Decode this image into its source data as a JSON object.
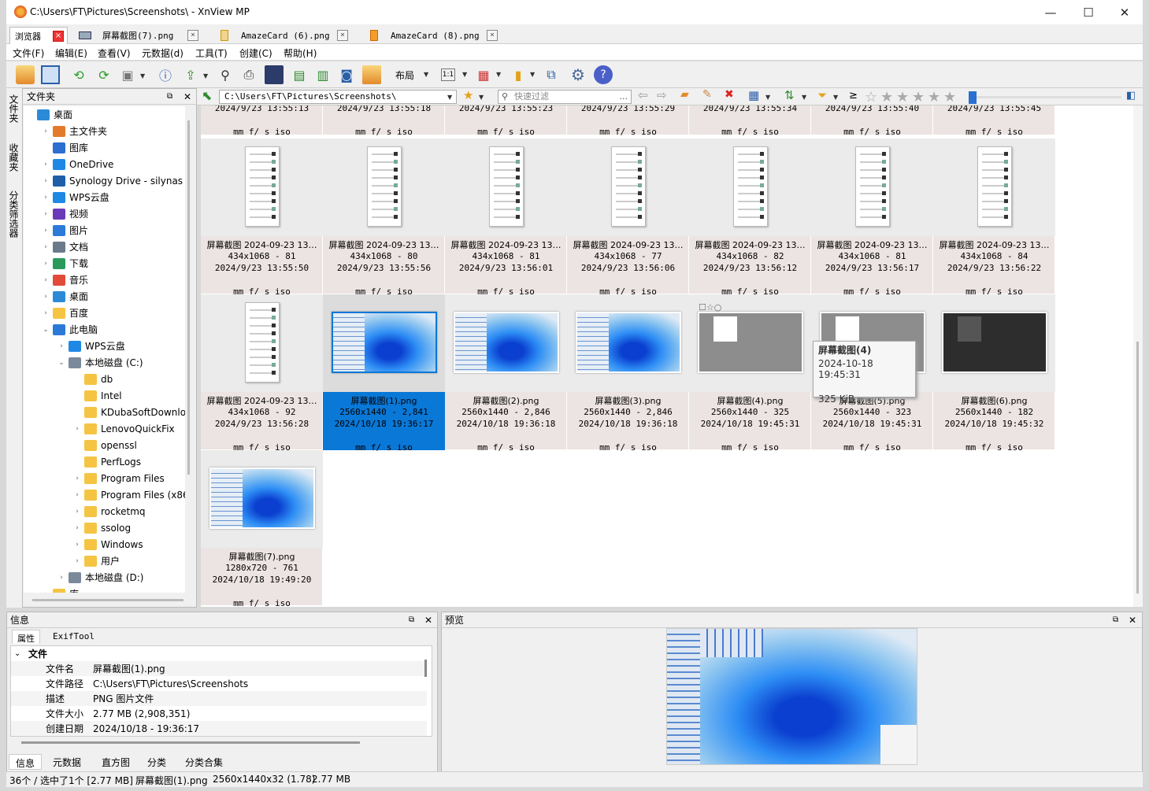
{
  "window": {
    "title": "C:\\Users\\FT\\Pictures\\Screenshots\\ - XnView MP",
    "minimize": "—",
    "maximize": "☐",
    "close": "✕"
  },
  "tabs": [
    {
      "label": "浏览器"
    },
    {
      "label": "屏幕截图(7).png"
    },
    {
      "label": "AmazeCard (6).png"
    },
    {
      "label": "AmazeCard (8).png"
    }
  ],
  "menu": [
    "文件(F)",
    "编辑(E)",
    "查看(V)",
    "元数据(d)",
    "工具(T)",
    "创建(C)",
    "帮助(H)"
  ],
  "toolbar": {
    "layout_label": "布局",
    "icons": [
      "open-folder-icon",
      "fullscreen-icon",
      "rotate-left-icon",
      "rotate-right-icon",
      "image-settings-icon",
      "info-icon",
      "export-icon",
      "binoculars-icon",
      "print-icon",
      "scanner-icon",
      "slideshow-icon",
      "batch-icon",
      "capture-icon",
      "desktop-icon",
      "grid-size-icon",
      "color-icon",
      "bookmark-icon",
      "compare-icon",
      "settings-icon",
      "help-icon"
    ]
  },
  "left_rail": [
    "文件夹",
    "收藏夹",
    "分类筛选器"
  ],
  "folder_panel": {
    "title": "文件夹",
    "tree": [
      {
        "label": "桌面",
        "depth": 0,
        "expander": "",
        "icon": "desktop"
      },
      {
        "label": "主文件夹",
        "depth": 1,
        "expander": "›",
        "icon": "home"
      },
      {
        "label": "图库",
        "depth": 1,
        "expander": "",
        "icon": "gallery"
      },
      {
        "label": "OneDrive",
        "depth": 1,
        "expander": "›",
        "icon": "cloud"
      },
      {
        "label": "Synology Drive - silynas",
        "depth": 1,
        "expander": "›",
        "icon": "synology"
      },
      {
        "label": "WPS云盘",
        "depth": 1,
        "expander": "›",
        "icon": "cloud"
      },
      {
        "label": "视频",
        "depth": 1,
        "expander": "›",
        "icon": "video"
      },
      {
        "label": "图片",
        "depth": 1,
        "expander": "›",
        "icon": "pictures"
      },
      {
        "label": "文档",
        "depth": 1,
        "expander": "›",
        "icon": "docs"
      },
      {
        "label": "下载",
        "depth": 1,
        "expander": "›",
        "icon": "download"
      },
      {
        "label": "音乐",
        "depth": 1,
        "expander": "›",
        "icon": "music"
      },
      {
        "label": "桌面",
        "depth": 1,
        "expander": "›",
        "icon": "desktop"
      },
      {
        "label": "百度",
        "depth": 1,
        "expander": "›",
        "icon": "folder"
      },
      {
        "label": "此电脑",
        "depth": 1,
        "expander": "⌄",
        "icon": "pc"
      },
      {
        "label": "WPS云盘",
        "depth": 2,
        "expander": "›",
        "icon": "cloud"
      },
      {
        "label": "本地磁盘 (C:)",
        "depth": 2,
        "expander": "⌄",
        "icon": "drive"
      },
      {
        "label": "db",
        "depth": 3,
        "expander": "",
        "icon": "folder"
      },
      {
        "label": "Intel",
        "depth": 3,
        "expander": "",
        "icon": "folder"
      },
      {
        "label": "KDubaSoftDownloads",
        "depth": 3,
        "expander": "",
        "icon": "folder"
      },
      {
        "label": "LenovoQuickFix",
        "depth": 3,
        "expander": "›",
        "icon": "folder"
      },
      {
        "label": "openssl",
        "depth": 3,
        "expander": "",
        "icon": "folder"
      },
      {
        "label": "PerfLogs",
        "depth": 3,
        "expander": "",
        "icon": "folder"
      },
      {
        "label": "Program Files",
        "depth": 3,
        "expander": "›",
        "icon": "folder"
      },
      {
        "label": "Program Files (x86)",
        "depth": 3,
        "expander": "›",
        "icon": "folder"
      },
      {
        "label": "rocketmq",
        "depth": 3,
        "expander": "›",
        "icon": "folder"
      },
      {
        "label": "ssolog",
        "depth": 3,
        "expander": "›",
        "icon": "folder"
      },
      {
        "label": "Windows",
        "depth": 3,
        "expander": "›",
        "icon": "folder"
      },
      {
        "label": "用户",
        "depth": 3,
        "expander": "›",
        "icon": "folder"
      },
      {
        "label": "本地磁盘 (D:)",
        "depth": 2,
        "expander": "›",
        "icon": "drive"
      },
      {
        "label": "库",
        "depth": 1,
        "expander": "›",
        "icon": "folder"
      }
    ]
  },
  "address": {
    "path": "C:\\Users\\FT\\Pictures\\Screenshots\\",
    "filter_placeholder": "快速过滤",
    "ge": "≥"
  },
  "thumbnails": {
    "row0": [
      {
        "date": "2024/9/23 13:55:13",
        "meta": "mm f/ s iso"
      },
      {
        "date": "2024/9/23 13:55:18",
        "meta": "mm f/ s iso"
      },
      {
        "date": "2024/9/23 13:55:23",
        "meta": "mm f/ s iso"
      },
      {
        "date": "2024/9/23 13:55:29",
        "meta": "mm f/ s iso"
      },
      {
        "date": "2024/9/23 13:55:34",
        "meta": "mm f/ s iso"
      },
      {
        "date": "2024/9/23 13:55:40",
        "meta": "mm f/ s iso"
      },
      {
        "date": "2024/9/23 13:55:45",
        "meta": "mm f/ s iso"
      }
    ],
    "row1": [
      {
        "name": "屏幕截图 2024-09-23 13…",
        "dims": "434x1068 - 81",
        "date": "2024/9/23 13:55:50",
        "meta": "mm f/ s iso",
        "kind": "phone"
      },
      {
        "name": "屏幕截图 2024-09-23 13…",
        "dims": "434x1068 - 80",
        "date": "2024/9/23 13:55:56",
        "meta": "mm f/ s iso",
        "kind": "phone"
      },
      {
        "name": "屏幕截图 2024-09-23 13…",
        "dims": "434x1068 - 81",
        "date": "2024/9/23 13:56:01",
        "meta": "mm f/ s iso",
        "kind": "phone"
      },
      {
        "name": "屏幕截图 2024-09-23 13…",
        "dims": "434x1068 - 77",
        "date": "2024/9/23 13:56:06",
        "meta": "mm f/ s iso",
        "kind": "phone"
      },
      {
        "name": "屏幕截图 2024-09-23 13…",
        "dims": "434x1068 - 82",
        "date": "2024/9/23 13:56:12",
        "meta": "mm f/ s iso",
        "kind": "phone"
      },
      {
        "name": "屏幕截图 2024-09-23 13…",
        "dims": "434x1068 - 81",
        "date": "2024/9/23 13:56:17",
        "meta": "mm f/ s iso",
        "kind": "phone"
      },
      {
        "name": "屏幕截图 2024-09-23 13…",
        "dims": "434x1068 - 84",
        "date": "2024/9/23 13:56:22",
        "meta": "mm f/ s iso",
        "kind": "phone"
      }
    ],
    "row2": [
      {
        "name": "屏幕截图 2024-09-23 13…",
        "dims": "434x1068 - 92",
        "date": "2024/9/23 13:56:28",
        "meta": "mm f/ s iso",
        "kind": "phone"
      },
      {
        "name": "屏幕截图(1).png",
        "dims": "2560x1440 - 2,841",
        "date": "2024/10/18 19:36:17",
        "meta": "mm f/ s iso",
        "kind": "bloom",
        "selected": true
      },
      {
        "name": "屏幕截图(2).png",
        "dims": "2560x1440 - 2,846",
        "date": "2024/10/18 19:36:18",
        "meta": "mm f/ s iso",
        "kind": "bloom"
      },
      {
        "name": "屏幕截图(3).png",
        "dims": "2560x1440 - 2,846",
        "date": "2024/10/18 19:36:18",
        "meta": "mm f/ s iso",
        "kind": "bloom"
      },
      {
        "name": "屏幕截图(4).png",
        "dims": "2560x1440 - 325",
        "date": "2024/10/18 19:45:31",
        "meta": "mm f/ s iso",
        "kind": "grey"
      },
      {
        "name": "屏幕截图(5).png",
        "dims": "2560x1440 - 323",
        "date": "2024/10/18 19:45:31",
        "meta": "mm f/ s iso",
        "kind": "grey"
      },
      {
        "name": "屏幕截图(6).png",
        "dims": "2560x1440 - 182",
        "date": "2024/10/18 19:45:32",
        "meta": "mm f/ s iso",
        "kind": "dark"
      }
    ],
    "row3": [
      {
        "name": "屏幕截图(7).png",
        "dims": "1280x720 - 761",
        "date": "2024/10/18 19:49:20",
        "meta": "mm f/ s iso",
        "kind": "bloom"
      }
    ]
  },
  "tooltip": {
    "name": "屏幕截图(4)",
    "date": "2024-10-18 19:45:31",
    "size": "325 KiB"
  },
  "info_panel": {
    "title": "信息",
    "subtabs": [
      "属性",
      "ExifTool"
    ],
    "section": "文件",
    "rows": [
      {
        "key": "文件名",
        "value": "屏幕截图(1).png"
      },
      {
        "key": "文件路径",
        "value": "C:\\Users\\FT\\Pictures\\Screenshots"
      },
      {
        "key": "描述",
        "value": "PNG 图片文件"
      },
      {
        "key": "文件大小",
        "value": "2.77 MB (2,908,351)"
      },
      {
        "key": "创建日期",
        "value": "2024/10/18 - 19:36:17"
      }
    ],
    "bottom_tabs": [
      "信息",
      "元数据",
      "直方图",
      "分类",
      "分类合集"
    ]
  },
  "preview_panel": {
    "title": "预览"
  },
  "status": {
    "count": "36个 / 选中了1个 [2.77 MB]",
    "file": "屏幕截图(1).png",
    "dims": "2560x1440x32 (1.78)",
    "size": "2.77 MB"
  },
  "colors": {
    "selection": "#0a78d7",
    "caption_bg": "#ece4e2",
    "folder": "#f5c443"
  }
}
